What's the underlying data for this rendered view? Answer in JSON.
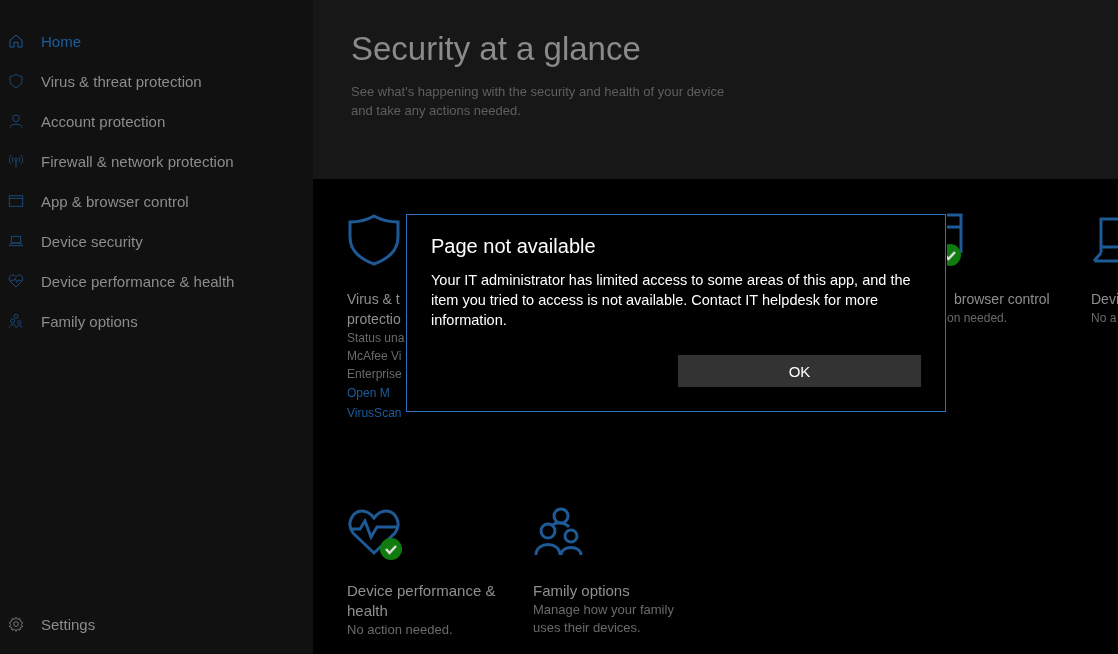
{
  "sidebar": {
    "items": [
      {
        "label": "Home",
        "selected": true
      },
      {
        "label": "Virus & threat protection",
        "selected": false
      },
      {
        "label": "Account protection",
        "selected": false
      },
      {
        "label": "Firewall & network protection",
        "selected": false
      },
      {
        "label": "App & browser control",
        "selected": false
      },
      {
        "label": "Device security",
        "selected": false
      },
      {
        "label": "Device performance & health",
        "selected": false
      },
      {
        "label": "Family options",
        "selected": false
      }
    ],
    "settings": {
      "label": "Settings"
    }
  },
  "header": {
    "title": "Security at a glance",
    "subtitle": "See what's happening with the security and health of your device and take any actions needed."
  },
  "tiles": [
    {
      "ok": false,
      "lines": [
        {
          "kind": "title",
          "text": "Virus & t"
        },
        {
          "kind": "title",
          "text": "protectio"
        },
        {
          "kind": "status",
          "text": "Status una"
        },
        {
          "kind": "status",
          "text": "McAfee Vi"
        },
        {
          "kind": "status",
          "text": "Enterprise"
        },
        {
          "kind": "link",
          "text": "Open M"
        },
        {
          "kind": "link",
          "text": "VirusScan"
        }
      ]
    },
    {
      "ok": true,
      "lines": [
        {
          "kind": "title",
          "text": "browser control"
        },
        {
          "kind": "status",
          "text": "on needed."
        }
      ]
    },
    {
      "ok": false,
      "lines": [
        {
          "kind": "title",
          "text": "Devi"
        },
        {
          "kind": "status",
          "text": "No a"
        }
      ]
    },
    {
      "ok": true,
      "lines": [
        {
          "kind": "title",
          "text": "Device performance & health"
        },
        {
          "kind": "status",
          "text": "No action needed."
        }
      ]
    },
    {
      "ok": false,
      "lines": [
        {
          "kind": "title",
          "text": "Family options"
        },
        {
          "kind": "status",
          "text": "Manage how your family uses their devices."
        }
      ]
    }
  ],
  "dialog": {
    "title": "Page not available",
    "message": "Your IT administrator has limited access to some areas of this app, and the item you tried to access is not available.  Contact IT helpdesk for more information.",
    "button": "OK"
  }
}
